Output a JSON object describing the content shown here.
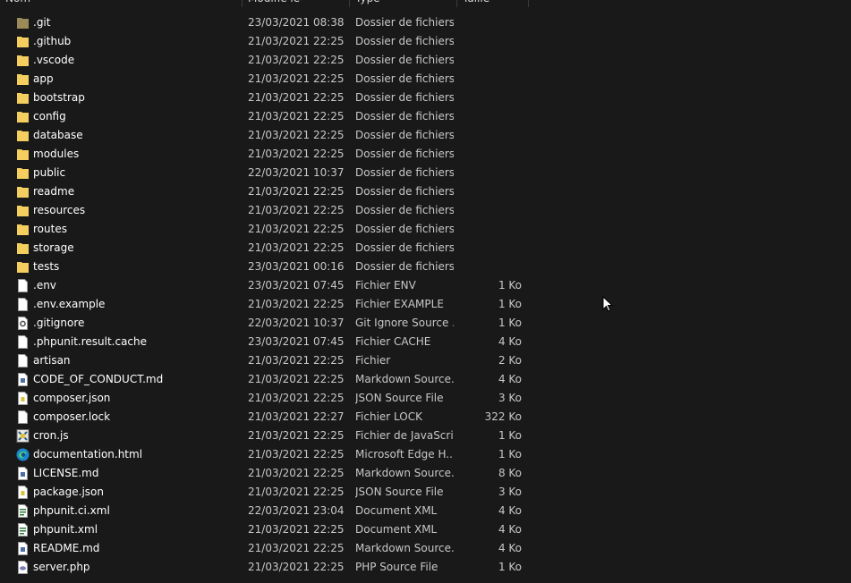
{
  "header": {
    "columns": [
      "Nom",
      "Modifié le",
      "Type",
      "Taille"
    ]
  },
  "files": [
    {
      "name": ".git",
      "modified": "23/03/2021 08:38",
      "type": "Dossier de fichiers",
      "size": "",
      "icon": "folder-dim-icon"
    },
    {
      "name": ".github",
      "modified": "21/03/2021 22:25",
      "type": "Dossier de fichiers",
      "size": "",
      "icon": "folder-icon"
    },
    {
      "name": ".vscode",
      "modified": "21/03/2021 22:25",
      "type": "Dossier de fichiers",
      "size": "",
      "icon": "folder-icon"
    },
    {
      "name": "app",
      "modified": "21/03/2021 22:25",
      "type": "Dossier de fichiers",
      "size": "",
      "icon": "folder-icon"
    },
    {
      "name": "bootstrap",
      "modified": "21/03/2021 22:25",
      "type": "Dossier de fichiers",
      "size": "",
      "icon": "folder-icon"
    },
    {
      "name": "config",
      "modified": "21/03/2021 22:25",
      "type": "Dossier de fichiers",
      "size": "",
      "icon": "folder-icon"
    },
    {
      "name": "database",
      "modified": "21/03/2021 22:25",
      "type": "Dossier de fichiers",
      "size": "",
      "icon": "folder-icon"
    },
    {
      "name": "modules",
      "modified": "21/03/2021 22:25",
      "type": "Dossier de fichiers",
      "size": "",
      "icon": "folder-icon"
    },
    {
      "name": "public",
      "modified": "22/03/2021 10:37",
      "type": "Dossier de fichiers",
      "size": "",
      "icon": "folder-icon"
    },
    {
      "name": "readme",
      "modified": "21/03/2021 22:25",
      "type": "Dossier de fichiers",
      "size": "",
      "icon": "folder-icon"
    },
    {
      "name": "resources",
      "modified": "21/03/2021 22:25",
      "type": "Dossier de fichiers",
      "size": "",
      "icon": "folder-icon"
    },
    {
      "name": "routes",
      "modified": "21/03/2021 22:25",
      "type": "Dossier de fichiers",
      "size": "",
      "icon": "folder-icon"
    },
    {
      "name": "storage",
      "modified": "21/03/2021 22:25",
      "type": "Dossier de fichiers",
      "size": "",
      "icon": "folder-icon"
    },
    {
      "name": "tests",
      "modified": "23/03/2021 00:16",
      "type": "Dossier de fichiers",
      "size": "",
      "icon": "folder-icon"
    },
    {
      "name": ".env",
      "modified": "23/03/2021 07:45",
      "type": "Fichier ENV",
      "size": "1 Ko",
      "icon": "file-icon"
    },
    {
      "name": ".env.example",
      "modified": "21/03/2021 22:25",
      "type": "Fichier EXAMPLE",
      "size": "1 Ko",
      "icon": "file-icon"
    },
    {
      "name": ".gitignore",
      "modified": "22/03/2021 10:37",
      "type": "Git Ignore Source ...",
      "size": "1 Ko",
      "icon": "gear-file-icon"
    },
    {
      "name": ".phpunit.result.cache",
      "modified": "23/03/2021 07:45",
      "type": "Fichier CACHE",
      "size": "4 Ko",
      "icon": "file-icon"
    },
    {
      "name": "artisan",
      "modified": "21/03/2021 22:25",
      "type": "Fichier",
      "size": "2 Ko",
      "icon": "file-icon"
    },
    {
      "name": "CODE_OF_CONDUCT.md",
      "modified": "21/03/2021 22:25",
      "type": "Markdown Source...",
      "size": "4 Ko",
      "icon": "markdown-file-icon"
    },
    {
      "name": "composer.json",
      "modified": "21/03/2021 22:25",
      "type": "JSON Source File",
      "size": "3 Ko",
      "icon": "json-file-icon"
    },
    {
      "name": "composer.lock",
      "modified": "21/03/2021 22:27",
      "type": "Fichier LOCK",
      "size": "322 Ko",
      "icon": "file-icon"
    },
    {
      "name": "cron.js",
      "modified": "21/03/2021 22:25",
      "type": "Fichier de JavaScript",
      "size": "1 Ko",
      "icon": "javascript-file-icon"
    },
    {
      "name": "documentation.html",
      "modified": "21/03/2021 22:25",
      "type": "Microsoft Edge H...",
      "size": "1 Ko",
      "icon": "edge-icon"
    },
    {
      "name": "LICENSE.md",
      "modified": "21/03/2021 22:25",
      "type": "Markdown Source...",
      "size": "8 Ko",
      "icon": "markdown-file-icon"
    },
    {
      "name": "package.json",
      "modified": "21/03/2021 22:25",
      "type": "JSON Source File",
      "size": "3 Ko",
      "icon": "json-file-icon"
    },
    {
      "name": "phpunit.ci.xml",
      "modified": "22/03/2021 23:04",
      "type": "Document XML",
      "size": "4 Ko",
      "icon": "xml-file-icon"
    },
    {
      "name": "phpunit.xml",
      "modified": "21/03/2021 22:25",
      "type": "Document XML",
      "size": "4 Ko",
      "icon": "xml-file-icon"
    },
    {
      "name": "README.md",
      "modified": "21/03/2021 22:25",
      "type": "Markdown Source...",
      "size": "4 Ko",
      "icon": "markdown-file-icon"
    },
    {
      "name": "server.php",
      "modified": "21/03/2021 22:25",
      "type": "PHP Source File",
      "size": "1 Ko",
      "icon": "php-file-icon"
    }
  ],
  "colors": {
    "background": "#191919",
    "folder": "#f4cf5f",
    "folder_dim": "#9c8a58",
    "text": "#ffffff",
    "secondary_text": "#c8c8c8"
  }
}
